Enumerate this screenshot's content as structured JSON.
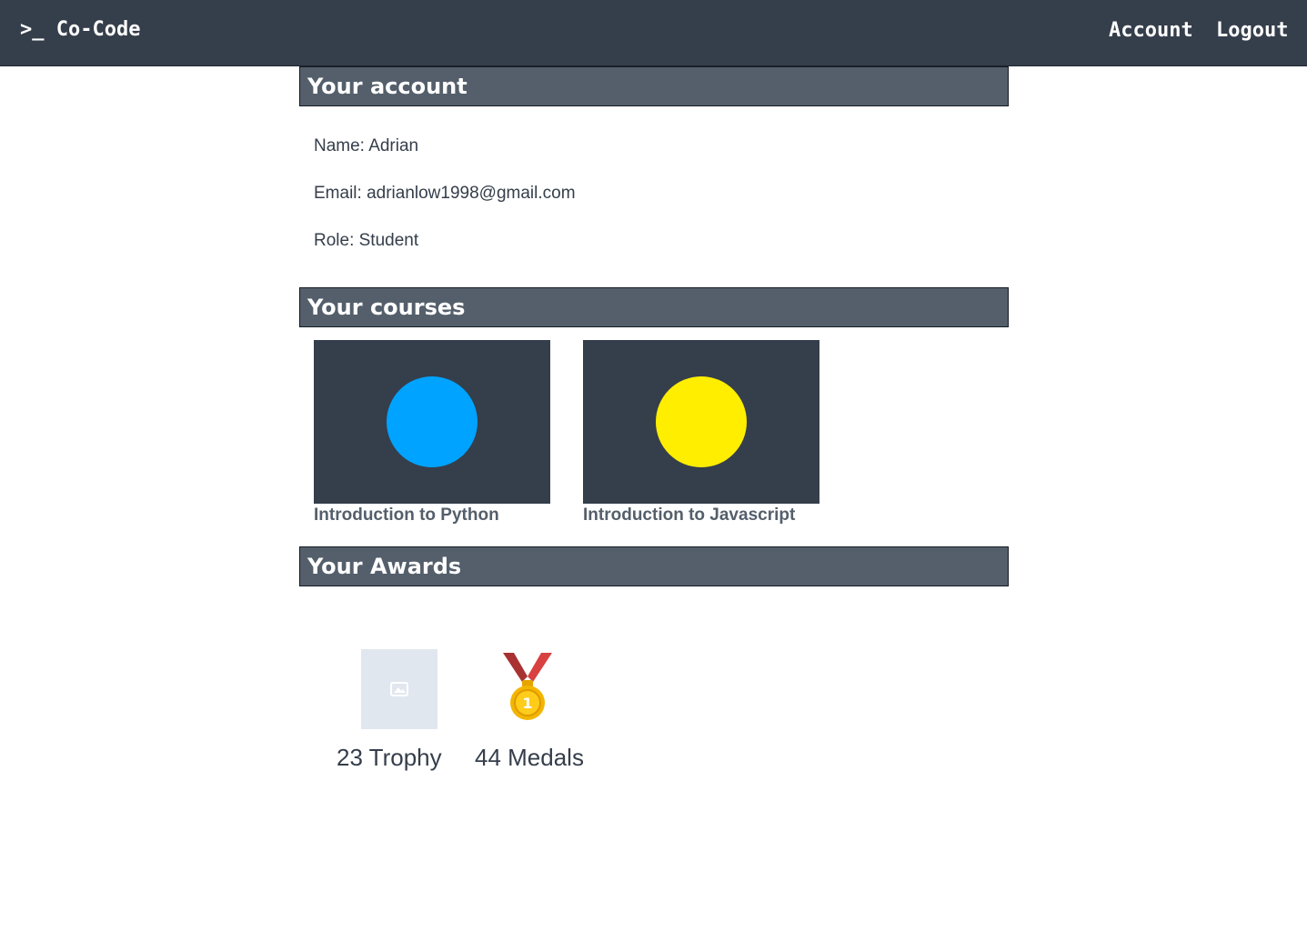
{
  "navbar": {
    "brand": ">_ Co-Code",
    "links": {
      "account": "Account",
      "logout": "Logout"
    }
  },
  "account": {
    "heading": "Your account",
    "name": "Name: Adrian",
    "email": "Email: adrianlow1998@gmail.com",
    "role": "Role: Student"
  },
  "courses": {
    "heading": "Your courses",
    "items": [
      {
        "title": "Introduction to Python",
        "color": "#00a3ff"
      },
      {
        "title": "Introduction to Javascript",
        "color": "#ffee00"
      }
    ]
  },
  "awards": {
    "heading": "Your Awards",
    "items": [
      {
        "label": "23 Trophy",
        "icon": "image-placeholder-icon"
      },
      {
        "label": "44 Medals",
        "icon": "gold-medal-icon"
      }
    ]
  },
  "colors": {
    "navbar_bg": "#353e4b",
    "header_bg": "#545f6b",
    "text": "#353e4b"
  }
}
